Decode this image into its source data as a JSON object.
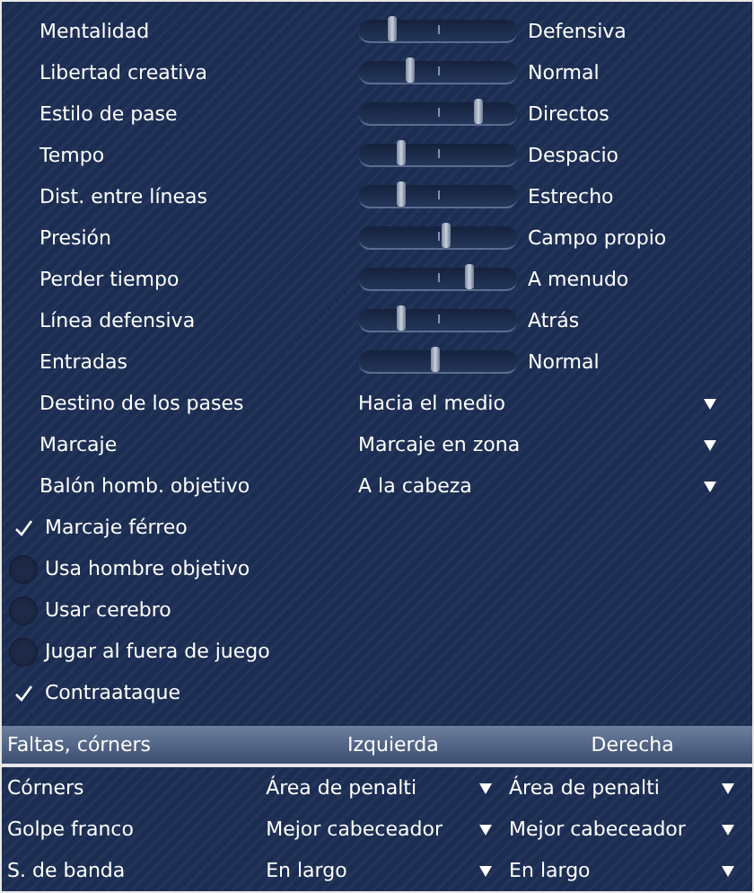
{
  "sliders": [
    {
      "label": "Mentalidad",
      "level": 0.2,
      "reading": "Defensiva"
    },
    {
      "label": "Libertad creativa",
      "level": 0.32,
      "reading": "Normal"
    },
    {
      "label": "Estilo de pase",
      "level": 0.75,
      "reading": "Directos"
    },
    {
      "label": "Tempo",
      "level": 0.26,
      "reading": "Despacio"
    },
    {
      "label": "Dist. entre líneas",
      "level": 0.26,
      "reading": "Estrecho"
    },
    {
      "label": "Presión",
      "level": 0.55,
      "reading": "Campo propio"
    },
    {
      "label": "Perder tiempo",
      "level": 0.69,
      "reading": "A menudo"
    },
    {
      "label": "Línea defensiva",
      "level": 0.26,
      "reading": "Atrás"
    },
    {
      "label": "Entradas",
      "level": 0.48,
      "reading": "Normal"
    }
  ],
  "dropdowns": [
    {
      "label": "Destino de los pases",
      "value": "Hacia el medio"
    },
    {
      "label": "Marcaje",
      "value": "Marcaje en zona"
    },
    {
      "label": "Balón homb. objetivo",
      "value": "A la cabeza"
    }
  ],
  "checkboxes": [
    {
      "label": "Marcaje férreo",
      "checked": true
    },
    {
      "label": "Usa hombre objetivo",
      "checked": false
    },
    {
      "label": "Usar cerebro",
      "checked": false
    },
    {
      "label": "Jugar al fuera de juego",
      "checked": false
    },
    {
      "label": "Contraataque",
      "checked": true
    }
  ],
  "set_pieces": {
    "columns": [
      "Faltas, córners",
      "Izquierda",
      "Derecha"
    ],
    "rows": [
      {
        "label": "Córners",
        "left": "Área de penalti",
        "right": "Área de penalti"
      },
      {
        "label": "Golpe franco",
        "left": "Mejor cabeceador",
        "right": "Mejor cabeceador"
      },
      {
        "label": "S. de banda",
        "left": "En largo",
        "right": "En largo"
      }
    ]
  }
}
